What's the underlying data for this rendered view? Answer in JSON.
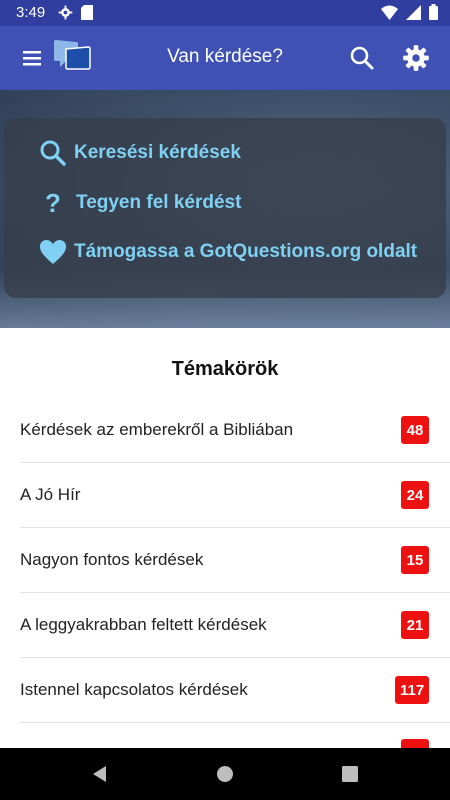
{
  "status_bar": {
    "time": "3:49"
  },
  "app_bar": {
    "title": "Van kérdése?"
  },
  "actions": [
    {
      "icon": "search-icon",
      "label": "Keresési kérdések"
    },
    {
      "icon": "question-mark-icon",
      "label": "Tegyen fel kérdést"
    },
    {
      "icon": "heart-icon",
      "label": "Támogassa a GotQuestions.org oldalt"
    }
  ],
  "topics": {
    "title": "Témakörök",
    "items": [
      {
        "label": "Kérdések az emberekről a Bibliában",
        "count": "48"
      },
      {
        "label": "A Jó Hír",
        "count": "24"
      },
      {
        "label": "Nagyon fontos kérdések",
        "count": "15"
      },
      {
        "label": "A leggyakrabban feltett kérdések",
        "count": "21"
      },
      {
        "label": "Istennel kapcsolatos kérdések",
        "count": "117"
      }
    ]
  },
  "colors": {
    "primary": "#3f51b5",
    "primary_dark": "#303f9f",
    "accent_text": "#7fd0f2",
    "badge": "#ee1111"
  }
}
